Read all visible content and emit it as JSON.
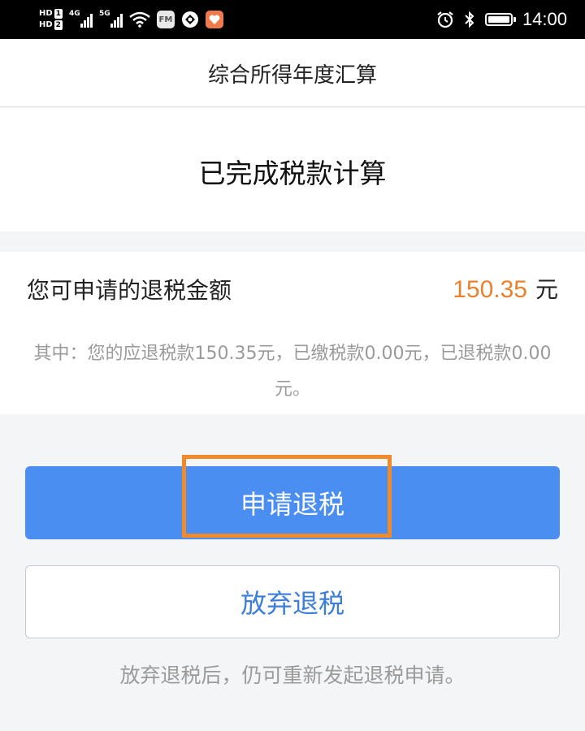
{
  "status_bar": {
    "hd1": "HD",
    "hd1_num": "1",
    "hd2": "HD",
    "hd2_num": "2",
    "net1": "4G",
    "net2": "5G",
    "fm": "FM",
    "time": "14:00"
  },
  "nav": {
    "title": "综合所得年度汇算"
  },
  "status": {
    "title": "已完成税款计算"
  },
  "refund": {
    "label": "您可申请的退税金额",
    "amount": "150.35",
    "unit": "元",
    "amount_color": "#e8822e",
    "detail": "其中：您的应退税款150.35元，已缴税款0.00元，已退税款0.00元。"
  },
  "actions": {
    "apply_label": "申请退税",
    "giveup_label": "放弃退税",
    "hint": "放弃退税后，仍可重新发起退税申请。",
    "primary_color": "#4a8ef1",
    "highlight_color": "#f08a2b"
  },
  "icons": [
    "wifi-icon",
    "fm-app-icon",
    "browser-app-icon",
    "health-app-icon",
    "alarm-icon",
    "bluetooth-icon",
    "battery-icon"
  ]
}
